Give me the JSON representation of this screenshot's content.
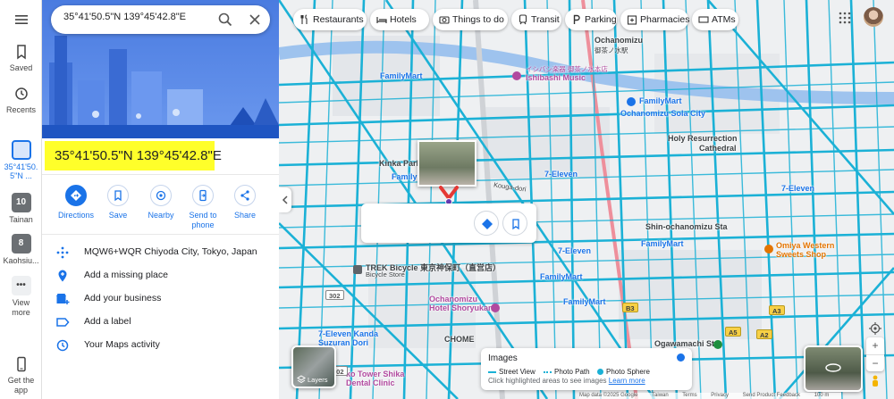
{
  "rail": {
    "saved": "Saved",
    "recents": "Recents",
    "current_place": "35°41'50.\n5\"N ...",
    "current_place_badge": "",
    "tainan": "Tainan",
    "tainan_badge": "10",
    "kaohsiung": "Kaohsiu...",
    "kaohsiung_badge": "8",
    "view_more": "View more",
    "get_app": "Get the app"
  },
  "search": {
    "value": "35°41'50.5\"N 139°45'42.8\"E"
  },
  "place": {
    "title": "35°41'50.5\"N 139°45'42.8\"E"
  },
  "actions": [
    {
      "label": "Directions"
    },
    {
      "label": "Save"
    },
    {
      "label": "Nearby"
    },
    {
      "label": "Send to phone"
    },
    {
      "label": "Share"
    }
  ],
  "info_rows": [
    {
      "label": "MQW6+WQR Chiyoda City, Tokyo, Japan",
      "icon": "plus-code-icon"
    },
    {
      "label": "Add a missing place",
      "icon": "add-place-icon"
    },
    {
      "label": "Add your business",
      "icon": "add-business-icon"
    },
    {
      "label": "Add a label",
      "icon": "label-icon"
    },
    {
      "label": "Your Maps activity",
      "icon": "history-icon"
    }
  ],
  "chips": [
    {
      "label": "Restaurants",
      "icon": "fork-knife-icon"
    },
    {
      "label": "Hotels",
      "icon": "bed-icon"
    },
    {
      "label": "Things to do",
      "icon": "camera-icon"
    },
    {
      "label": "Transit",
      "icon": "train-icon"
    },
    {
      "label": "Parking",
      "icon": "parking-icon"
    },
    {
      "label": "Pharmacies",
      "icon": "pharmacy-icon"
    },
    {
      "label": "ATMs",
      "icon": "atm-icon"
    }
  ],
  "map_labels": {
    "ochanomizu": "Ochanomizu",
    "ochanomizu_jp": "御茶ノ水",
    "ochanomizu_st_jp": "御茶ノ水駅",
    "rakki": "イシバシ楽器 御茶ノ水本店",
    "ishibashi": "Ishibashi Music",
    "ochanomizu_sola": "Ochanomizu Sola City",
    "holy_resurrection": "Holy Resurrection",
    "cathedral": "Cathedral",
    "kinka": "Kinka Park",
    "familymart_1": "FamilyMart",
    "familymart_2": "FamilyMart",
    "familymart_3": "FamilyMart",
    "familymart_4": "FamilyMart",
    "familymart_5": "FamilyMart",
    "familymart_6": "FamilyMart",
    "seven_1": "7-Eleven",
    "seven_2": "7-Eleven",
    "seven_3": "7-Eleven",
    "kougadori": "Kouga-dori",
    "shin_ochanomizu": "Shin-ochanomizu Sta",
    "omiya": "Omiya Western",
    "omiya2": "Sweets Shop",
    "trek": "TREK Bicycle 東京神保町（直営店）",
    "trek_en": "Bicycle Store",
    "hotel": "Ochanomizu",
    "hotel2": "Hotel Shoryukan",
    "suzuran": "7-Eleven Kanda",
    "suzuran2": "Suzuran Dori",
    "chome": "CHOME",
    "ogawamachi": "Ogawamachi St",
    "shika": "ko Tower Shika",
    "dental": "Dental Clinic",
    "r302a": "302",
    "r302b": "302",
    "b3": "B3",
    "a5": "A5",
    "a2": "A2",
    "a3": "A3"
  },
  "layers_label": "Layers",
  "legend": {
    "title": "Images",
    "street_view": "Street View",
    "photo_path": "Photo Path",
    "photo_sphere": "Photo Sphere",
    "note": "Click highlighted areas to see images",
    "learn_more": "Learn more"
  },
  "footer": {
    "map_data": "Map data ©2025 Google",
    "taiwan": "Taiwan",
    "terms": "Terms",
    "privacy": "Privacy",
    "feedback": "Send Product Feedback",
    "scale": "100 m"
  },
  "colors": {
    "accent": "#1a73e8",
    "highlight": "#ffff2a",
    "street_view_lines": "#1bb1d6",
    "marker": "#e53935"
  }
}
